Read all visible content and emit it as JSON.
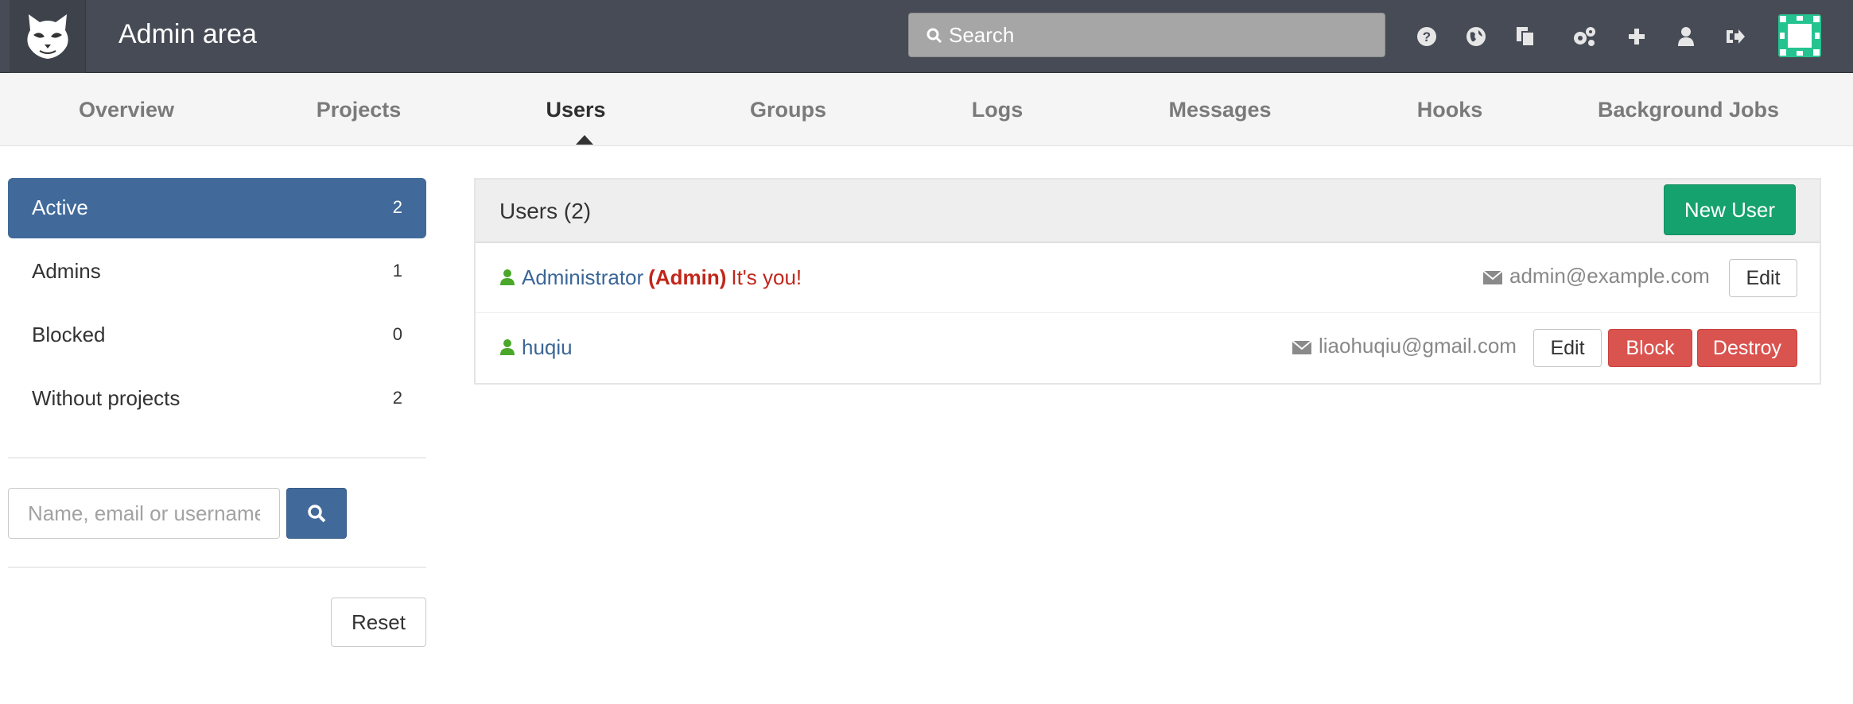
{
  "header": {
    "title": "Admin area",
    "search_placeholder": "Search",
    "icons": [
      "help-icon",
      "globe-icon",
      "copy-icon",
      "settings-icon",
      "plus-icon",
      "user-icon",
      "sign-out-icon"
    ]
  },
  "nav": {
    "tabs": [
      {
        "label": "Overview",
        "active": false
      },
      {
        "label": "Projects",
        "active": false
      },
      {
        "label": "Users",
        "active": true
      },
      {
        "label": "Groups",
        "active": false
      },
      {
        "label": "Logs",
        "active": false
      },
      {
        "label": "Messages",
        "active": false
      },
      {
        "label": "Hooks",
        "active": false
      },
      {
        "label": "Background Jobs",
        "active": false
      }
    ]
  },
  "sidebar": {
    "filters": [
      {
        "label": "Active",
        "count": "2",
        "active": true
      },
      {
        "label": "Admins",
        "count": "1",
        "active": false
      },
      {
        "label": "Blocked",
        "count": "0",
        "active": false
      },
      {
        "label": "Without projects",
        "count": "2",
        "active": false
      }
    ],
    "search_placeholder": "Name, email or username",
    "reset_label": "Reset"
  },
  "users_panel": {
    "title": "Users (2)",
    "new_user_label": "New User",
    "users": [
      {
        "name": "Administrator",
        "admin_tag": "(Admin)",
        "self_tag": "It's you!",
        "email": "admin@example.com",
        "edit_label": "Edit"
      },
      {
        "name": "huqiu",
        "email": "liaohuqiu@gmail.com",
        "edit_label": "Edit",
        "block_label": "Block",
        "destroy_label": "Destroy"
      }
    ]
  },
  "colors": {
    "topbar": "#464b55",
    "accent_blue": "#416a9b",
    "success_green": "#16a26e",
    "danger_red": "#d9534f",
    "admin_red": "#c1261a"
  }
}
